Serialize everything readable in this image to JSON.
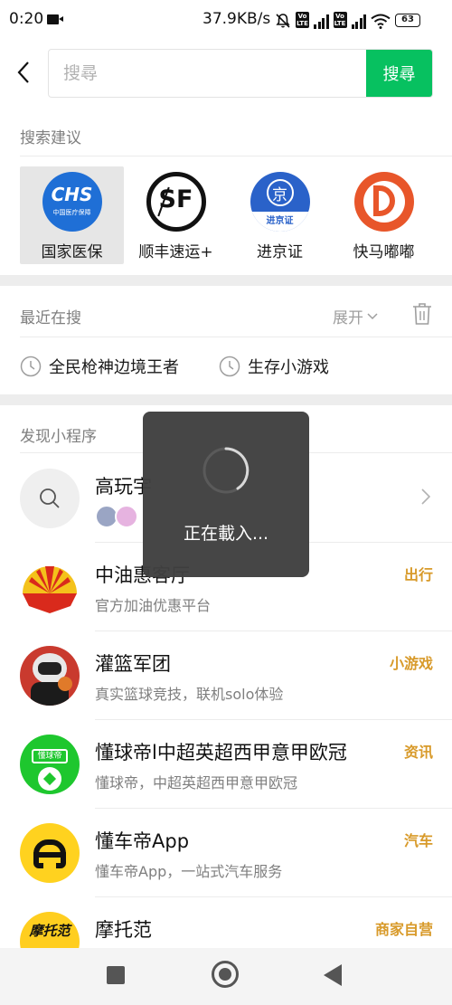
{
  "status_bar": {
    "time": "0:20",
    "net_speed": "37.9KB/s",
    "volte_1": "Vo LTE",
    "volte_2": "Vo LTE",
    "battery": "63"
  },
  "search": {
    "placeholder": "搜尋",
    "value": "",
    "button_label": "搜尋"
  },
  "suggestions": {
    "title": "搜索建议",
    "items": [
      {
        "label": "国家医保",
        "icon": "chs-logo-icon",
        "color": "#1f6fd6",
        "logo_text": "CHS",
        "logo_sub": "中国医疗保障"
      },
      {
        "label": "顺丰速运+",
        "icon": "sf-logo-icon",
        "color": "#111111",
        "logo_text": "SF"
      },
      {
        "label": "进京证",
        "icon": "jingzheng-logo-icon",
        "color": "#2a62c9",
        "logo_text": "京",
        "logo_sub": "进京证"
      },
      {
        "label": "快马嘟嘟",
        "icon": "kuaima-logo-icon",
        "color": "#e8562a"
      }
    ]
  },
  "recent": {
    "title": "最近在搜",
    "expand_label": "展开",
    "items": [
      "全民枪神边境王者",
      "生存小游戏"
    ]
  },
  "discover": {
    "title": "发现小程序",
    "items": [
      {
        "name": "高玩宇",
        "desc": "",
        "tag": "",
        "icon": "search-icon"
      },
      {
        "name": "中油惠客厅",
        "desc": "官方加油优惠平台",
        "tag": "出行",
        "icon": "petrochina-logo-icon"
      },
      {
        "name": "灌篮军团",
        "desc": "真实篮球竞技，联机solo体验",
        "tag": "小游戏",
        "icon": "basketball-avatar-icon"
      },
      {
        "name": "懂球帝l中超英超西甲意甲欧冠",
        "desc": "懂球帝，中超英超西甲意甲欧冠",
        "tag": "资讯",
        "icon": "dongqiudi-logo-icon",
        "logo_text": "懂球帝"
      },
      {
        "name": "懂车帝App",
        "desc": "懂车帝App，一站式汽车服务",
        "tag": "汽车",
        "icon": "dongchedi-logo-icon"
      },
      {
        "name": "摩托范",
        "desc": "",
        "tag": "商家自营",
        "icon": "motofan-logo-icon",
        "logo_text": "摩托范"
      }
    ]
  },
  "loading": {
    "text": "正在載入..."
  },
  "colors": {
    "accent": "#07c160",
    "tag": "#d89a2a"
  }
}
